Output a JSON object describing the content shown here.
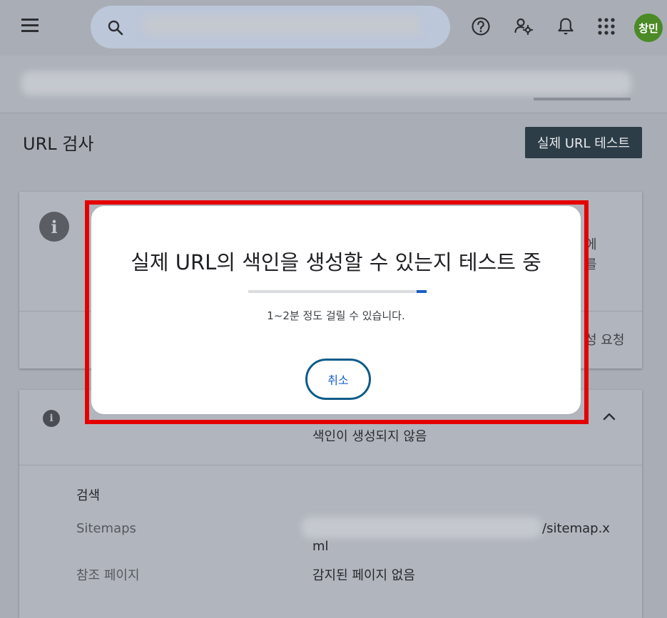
{
  "page": {
    "title": "URL 검사",
    "live_test_button": "실제 URL 테스트"
  },
  "topbar": {
    "avatar_text": "창민"
  },
  "card1": {
    "right_fragment_1": "에",
    "right_fragment_2": "를",
    "index_request_fragment": "성 요청"
  },
  "card2": {
    "status_value": "색인이 생성되지 않음",
    "section_search": "검색",
    "sitemaps_label": "Sitemaps",
    "sitemaps_value_part1": "/sitemap.x",
    "sitemaps_value_part2": "ml",
    "referring_label": "참조 페이지",
    "referring_value": "감지된 페이지 없음"
  },
  "dialog": {
    "title": "실제 URL의 색인을 생성할 수 있는지 테스트 중",
    "subtitle": "1~2분 정도 걸릴 수 있습니다.",
    "cancel_label": "취소"
  },
  "icons": {
    "menu": "menu-icon",
    "search": "search-icon",
    "help": "help-icon",
    "settings": "user-settings-icon",
    "notifications": "bell-icon",
    "apps": "apps-grid-icon",
    "info": "info-icon",
    "chevron": "chevron-up-icon"
  },
  "colors": {
    "highlight": "#e50000",
    "primary_blue": "#1a5fc8",
    "avatar": "#4b8a26",
    "dark_button": "#2d3d48"
  }
}
